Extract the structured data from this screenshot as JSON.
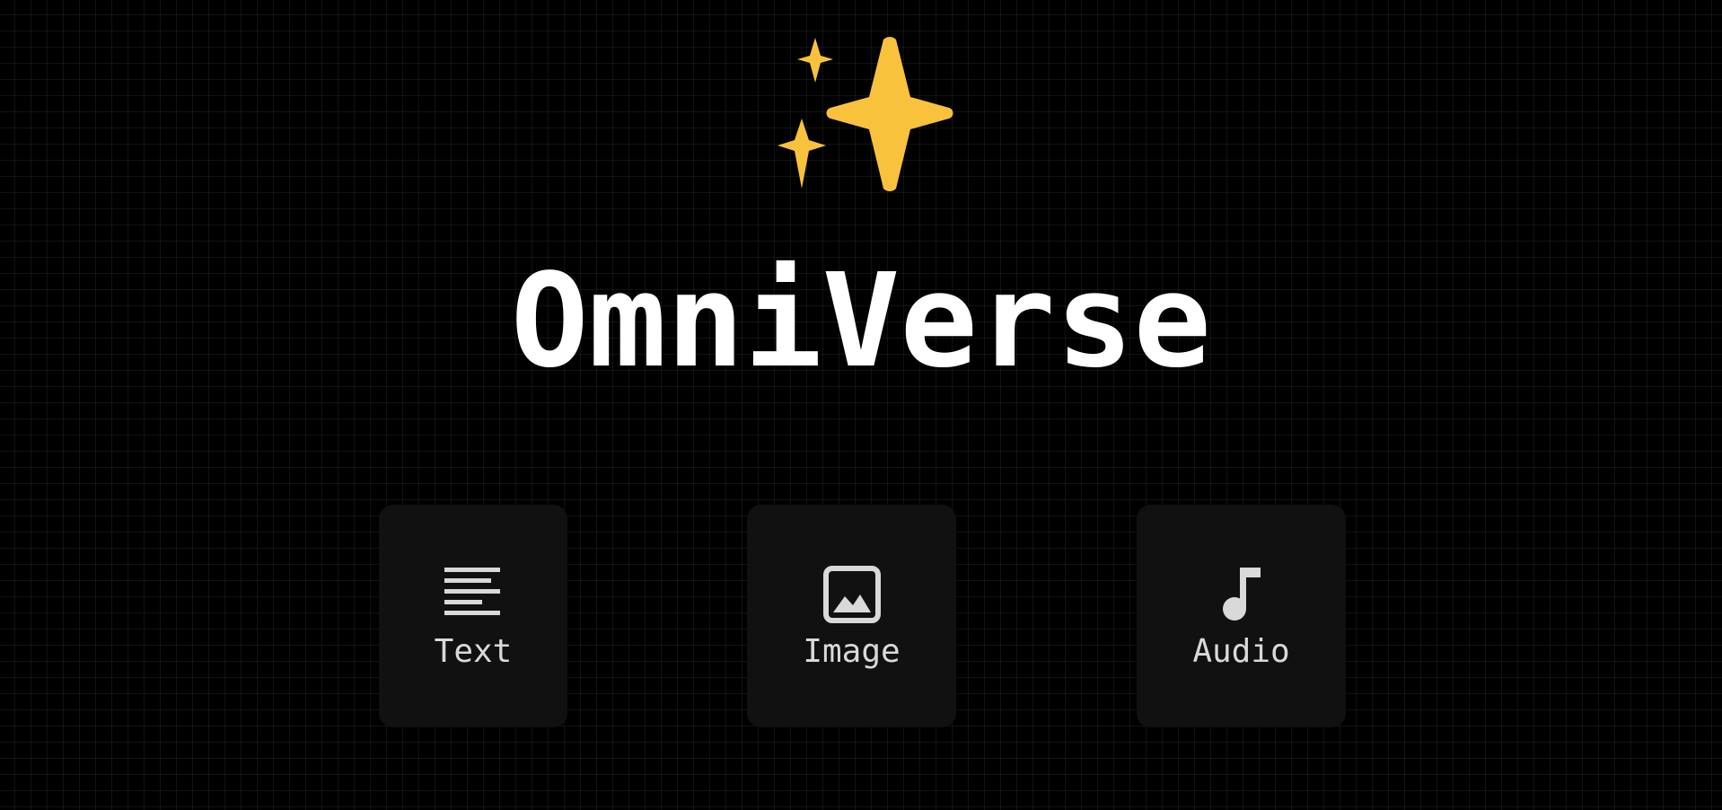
{
  "app": {
    "title": "OmniVerse",
    "logo_icon": "sparkles-icon",
    "accent_color": "#F9C23C"
  },
  "modes": [
    {
      "label": "Text",
      "icon": "text-lines-icon"
    },
    {
      "label": "Image",
      "icon": "image-icon"
    },
    {
      "label": "Audio",
      "icon": "music-note-icon"
    }
  ]
}
